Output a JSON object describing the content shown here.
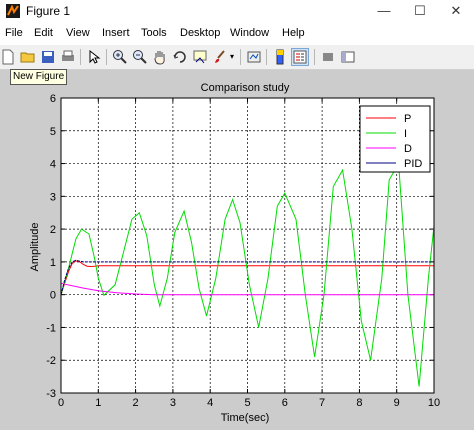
{
  "window": {
    "title": "Figure 1",
    "minimize_glyph": "—",
    "maximize_glyph": "☐",
    "close_glyph": "✕"
  },
  "menu": [
    "File",
    "Edit",
    "View",
    "Insert",
    "Tools",
    "Desktop",
    "Window",
    "Help"
  ],
  "toolbar": {
    "icons": [
      "new-figure-icon",
      "open-file-icon",
      "save-icon",
      "print-icon",
      "pointer-arrow-icon",
      "zoom-in-icon",
      "zoom-out-icon",
      "pan-hand-icon",
      "rotate-3d-icon",
      "data-cursor-icon",
      "brush-icon",
      "link-plot-icon",
      "colorbar-icon",
      "legend-icon",
      "hide-plot-tools-icon",
      "show-plot-tools-icon"
    ],
    "tooltip": "New Figure"
  },
  "colors": {
    "P": "#ff0000",
    "I": "#00dd00",
    "D": "#ff00ff",
    "PID": "#000080"
  },
  "chart_data": {
    "type": "line",
    "title": "Comparison study",
    "xlabel": "Time(sec)",
    "ylabel": "Amplitude",
    "xlim": [
      0,
      10
    ],
    "ylim": [
      -3,
      6
    ],
    "xticks": [
      0,
      1,
      2,
      3,
      4,
      5,
      6,
      7,
      8,
      9,
      10
    ],
    "yticks": [
      -3,
      -2,
      -1,
      0,
      1,
      2,
      3,
      4,
      5,
      6
    ],
    "grid": true,
    "legend_position": "top-right",
    "series": [
      {
        "name": "P",
        "color": "#ff0000",
        "x": [
          0,
          0.1,
          0.2,
          0.3,
          0.4,
          0.5,
          0.6,
          0.7,
          0.8,
          0.9,
          1.0,
          2,
          4,
          6,
          8,
          10
        ],
        "y": [
          0,
          0.35,
          0.7,
          0.95,
          1.03,
          1.0,
          0.92,
          0.87,
          0.86,
          0.87,
          0.88,
          0.88,
          0.88,
          0.88,
          0.88,
          0.88
        ]
      },
      {
        "name": "I",
        "color": "#00dd00",
        "x": [
          0,
          0.2,
          0.4,
          0.55,
          0.75,
          0.9,
          1.0,
          1.15,
          1.45,
          1.7,
          1.9,
          2.1,
          2.3,
          2.5,
          2.65,
          2.85,
          3.05,
          3.3,
          3.5,
          3.7,
          3.9,
          4.15,
          4.4,
          4.6,
          4.8,
          5.05,
          5.3,
          5.55,
          5.8,
          6.0,
          6.3,
          6.55,
          6.8,
          7.05,
          7.3,
          7.55,
          7.8,
          8.05,
          8.3,
          8.6,
          8.8,
          9.05,
          9.3,
          9.6,
          9.85,
          10
        ],
        "y": [
          0,
          0.8,
          1.7,
          2.0,
          1.85,
          1.1,
          0.5,
          -0.02,
          0.3,
          1.4,
          2.3,
          2.5,
          1.8,
          0.3,
          -0.35,
          0.5,
          1.9,
          2.55,
          1.6,
          0.2,
          -0.65,
          0.5,
          2.3,
          2.9,
          2.2,
          0.3,
          -1.0,
          0.5,
          2.7,
          3.1,
          2.3,
          0.0,
          -1.9,
          0.0,
          3.3,
          3.8,
          2.0,
          -0.8,
          -2.0,
          0.5,
          3.5,
          4.0,
          0.0,
          -2.8,
          0.5,
          2.1
        ]
      },
      {
        "name": "D",
        "color": "#ff00ff",
        "x": [
          0,
          0.1,
          0.3,
          0.6,
          1.0,
          1.5,
          2.0,
          2.5,
          3,
          4,
          5,
          6,
          7,
          8,
          9,
          10
        ],
        "y": [
          0.35,
          0.32,
          0.27,
          0.2,
          0.12,
          0.06,
          0.02,
          0.0,
          0.0,
          0.0,
          0.0,
          0.0,
          0.0,
          0.0,
          0.0,
          0.0
        ]
      },
      {
        "name": "PID",
        "color": "#000080",
        "x": [
          0,
          0.1,
          0.2,
          0.3,
          0.4,
          0.5,
          0.6,
          0.8,
          1.0,
          2,
          4,
          6,
          8,
          10
        ],
        "y": [
          0,
          0.45,
          0.8,
          1.0,
          1.05,
          1.02,
          1.0,
          1.0,
          1.0,
          1.0,
          1.0,
          1.0,
          1.0,
          1.0
        ]
      }
    ]
  }
}
